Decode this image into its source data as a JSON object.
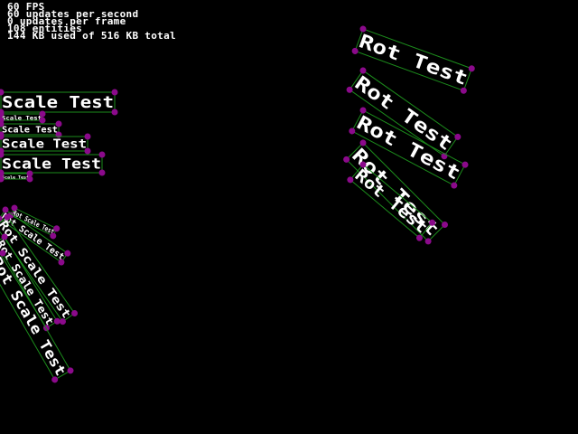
{
  "stats": {
    "fps": "60 FPS",
    "updates_per_second": "60 updates per second",
    "updates_per_frame": "0 updates per frame",
    "entities": "108 entities",
    "memory": "144 KB used of 516 KB total"
  },
  "labels": {
    "scale": "Scale Test",
    "rot": "Rot Test",
    "rot_scale": "Rot Scale Test"
  },
  "colors": {
    "background": "#000000",
    "text": "#ffffff",
    "bounding_box": "#1c8c1c",
    "corner_marker": "#8b0a8b"
  }
}
